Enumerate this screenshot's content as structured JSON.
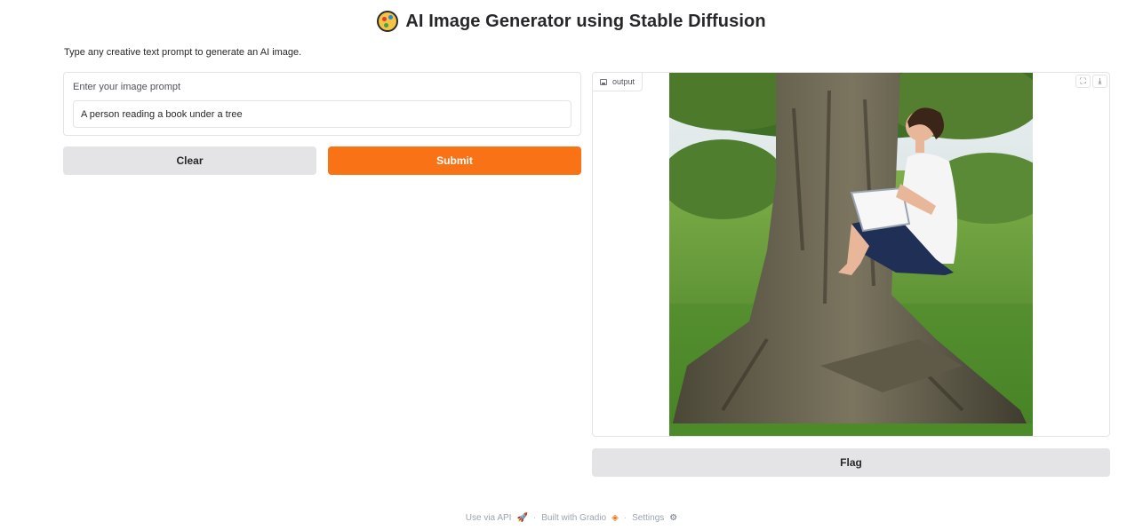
{
  "header": {
    "title": "AI Image Generator using Stable Diffusion",
    "icon": "artist-palette-icon"
  },
  "description": "Type any creative text prompt to generate an AI image.",
  "prompt": {
    "label": "Enter your image prompt",
    "value": "A person reading a book under a tree"
  },
  "buttons": {
    "clear": "Clear",
    "submit": "Submit",
    "flag": "Flag"
  },
  "output": {
    "label": "output",
    "image_description": "woman in white t-shirt reading a book sitting on tree roots"
  },
  "footer": {
    "api": "Use via API",
    "built": "Built with Gradio",
    "settings": "Settings",
    "separator": "·"
  },
  "colors": {
    "accent": "#f97316",
    "secondary_button": "#e4e4e7",
    "border": "#e4e4e7"
  }
}
